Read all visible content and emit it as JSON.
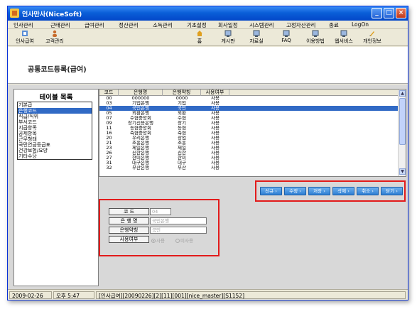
{
  "window": {
    "title": "인사만사(NiceSoft)"
  },
  "menu": [
    "인사관리",
    "근태관리",
    "급여관리",
    "정산관리",
    "소득관리",
    "기초설정",
    "회사일정",
    "시스템관리",
    "고정자산관리",
    "종료",
    "LogOn"
  ],
  "toolbar": {
    "left": [
      "인사급여",
      "고객관리"
    ],
    "right": [
      "홈",
      "게시판",
      "자료실",
      "FAQ",
      "이용방법",
      "웹서비스",
      "개인정보"
    ]
  },
  "page": {
    "title": "공통코드등록(급여)"
  },
  "table_list": {
    "title": "테이블 목록",
    "items": [
      "기본급",
      "은행코드",
      "직급/직위",
      "부서코드",
      "지급항목",
      "공제항목",
      "근무형태",
      "국민연금등급표",
      "건강보험/요양",
      "기타수당"
    ],
    "selected_index": 1
  },
  "grid": {
    "columns": [
      "코드",
      "은행명",
      "은행약칭",
      "사용여부"
    ],
    "selected_index": 2,
    "rows": [
      [
        "00",
        "000000",
        "0000",
        "사용"
      ],
      [
        "03",
        "기업은행",
        "기업",
        "사용"
      ],
      [
        "04",
        "국민은행",
        "국민",
        "사용"
      ],
      [
        "05",
        "외환은행",
        "외환",
        "사용"
      ],
      [
        "07",
        "수협중앙회",
        "수협",
        "사용"
      ],
      [
        "09",
        "장기신용은행",
        "장기",
        "사용"
      ],
      [
        "11",
        "농협중앙회",
        "농협",
        "사용"
      ],
      [
        "16",
        "축협중앙회",
        "축협",
        "사용"
      ],
      [
        "20",
        "우리은행",
        "상업",
        "사용"
      ],
      [
        "21",
        "조흥은행",
        "조흥",
        "사용"
      ],
      [
        "23",
        "제일은행",
        "제일",
        "사용"
      ],
      [
        "26",
        "신한은행",
        "신한",
        "사용"
      ],
      [
        "27",
        "한미은행",
        "한미",
        "사용"
      ],
      [
        "31",
        "대구은행",
        "대구",
        "사용"
      ],
      [
        "32",
        "부산은행",
        "부산",
        "사용"
      ]
    ]
  },
  "actions": [
    "신규",
    "수정",
    "저장",
    "삭제",
    "취소",
    "닫기"
  ],
  "form": {
    "code_label": "코    드",
    "code_value": "04",
    "bank_label": "은 행 명",
    "bank_value": "국민은행",
    "abbr_label": "은행약칭",
    "abbr_value": "국민",
    "use_label": "사용여부",
    "use_option": "사용",
    "nonuse_option": "미사용",
    "use_selected": "사용"
  },
  "status": [
    "2009-02-26",
    "오후 5:47",
    "[인사급여][20090226][2][11][001][nice_master][S1152]"
  ],
  "colors": {
    "title_bar": "#0a5fd8",
    "selection": "#316ac5",
    "highlight_border": "#e21b1b",
    "action_button": "#2e7fd3"
  }
}
